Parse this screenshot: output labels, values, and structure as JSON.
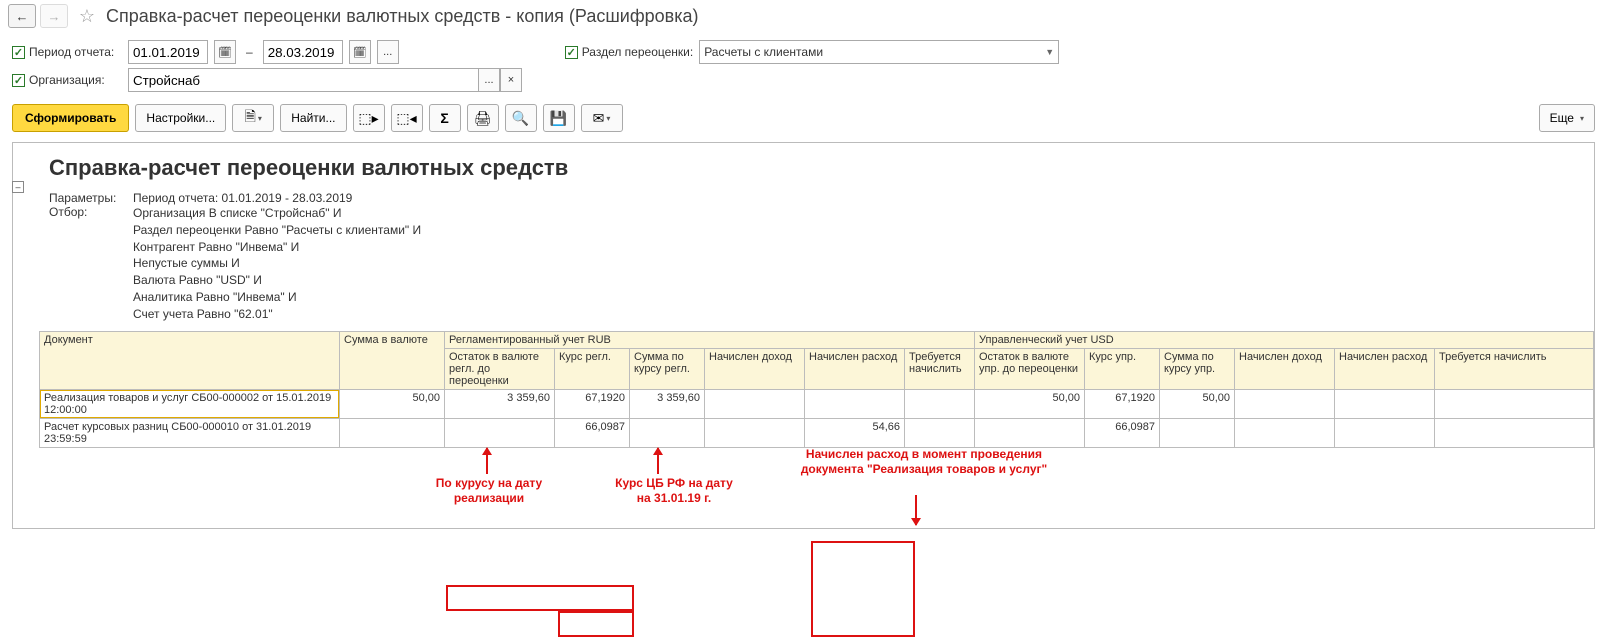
{
  "title": "Справка-расчет переоценки валютных средств - копия (Расшифровка)",
  "filters": {
    "period_label": "Период отчета:",
    "date_from": "01.01.2019",
    "date_to": "28.03.2019",
    "org_label": "Организация:",
    "org_value": "Стройснаб",
    "section_label": "Раздел переоценки:",
    "section_value": "Расчеты с клиентами"
  },
  "toolbar": {
    "form_btn": "Сформировать",
    "settings_btn": "Настройки...",
    "find_btn": "Найти...",
    "more_btn": "Еще"
  },
  "report": {
    "title": "Справка-расчет переоценки валютных средств",
    "params_label": "Параметры:",
    "params_value": "Период отчета: 01.01.2019 - 28.03.2019",
    "filter_label": "Отбор:",
    "filter_lines": [
      "Организация В списке \"Стройснаб\" И",
      "Раздел переоценки Равно \"Расчеты с клиентами\" И",
      "Контрагент Равно \"Инвема\" И",
      "Непустые суммы И",
      "Валюта Равно \"USD\" И",
      "Аналитика Равно \"Инвема\" И",
      "Счет учета Равно \"62.01\""
    ]
  },
  "annotations": {
    "top": "Начислен расход в момент проведения документа \"Реализация товаров и услуг\"",
    "bottom1_l1": "По курусу на дату",
    "bottom1_l2": "реализации",
    "bottom2_l1": "Курс ЦБ РФ на дату",
    "bottom2_l2": "на 31.01.19 г."
  },
  "headers": {
    "doc": "Документ",
    "amount_cur": "Сумма в валюте",
    "reg_group": "Регламентированный учет RUB",
    "mgmt_group": "Управленческий учет USD",
    "bal_before": "Остаток в валюте регл. до переоценки",
    "rate_reg": "Курс регл.",
    "sum_rate_reg": "Сумма по курсу регл.",
    "income": "Начислен доход",
    "expense": "Начислен расход",
    "required": "Требуется начислить",
    "bal_before_u": "Остаток в валюте упр. до переоценки",
    "rate_u": "Курс упр.",
    "sum_rate_u": "Сумма по курсу упр.",
    "income_u": "Начислен доход",
    "expense_u": "Начислен расход",
    "required_u": "Требуется начислить"
  },
  "rows": [
    {
      "doc": "Реализация товаров и услуг СБ00-000002 от 15.01.2019 12:00:00",
      "amount_cur": "50,00",
      "bal_before": "3 359,60",
      "rate_reg": "67,1920",
      "sum_rate_reg": "3 359,60",
      "income": "",
      "expense": "",
      "required": "",
      "bal_before_u": "50,00",
      "rate_u": "67,1920",
      "sum_rate_u": "50,00",
      "income_u": "",
      "expense_u": "",
      "required_u": ""
    },
    {
      "doc": "Расчет курсовых разниц СБ00-000010 от 31.01.2019 23:59:59",
      "amount_cur": "",
      "bal_before": "",
      "rate_reg": "66,0987",
      "sum_rate_reg": "",
      "income": "",
      "expense": "54,66",
      "required": "",
      "bal_before_u": "",
      "rate_u": "66,0987",
      "sum_rate_u": "",
      "income_u": "",
      "expense_u": "",
      "required_u": ""
    }
  ]
}
